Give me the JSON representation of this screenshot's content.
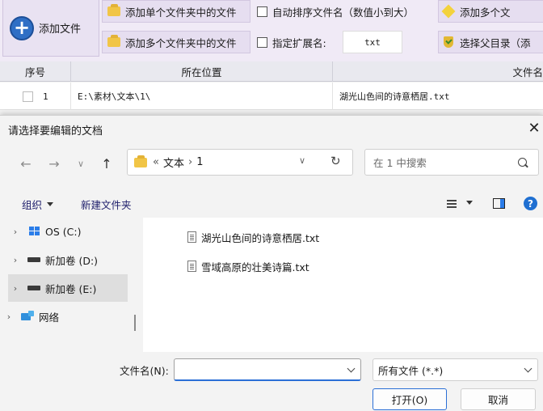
{
  "app": {
    "add_file_label": "添加文件",
    "toolbar": {
      "add_single_folder": "添加单个文件夹中的文件",
      "add_multi_folder": "添加多个文件夹中的文件",
      "auto_sort": "自动排序文件名（数值小到大）",
      "specify_ext_label": "指定扩展名:",
      "ext_value": "txt",
      "add_multi_right": "添加多个文",
      "select_parent": "选择父目录（添"
    },
    "grid": {
      "headers": [
        "序号",
        "所在位置",
        "文件名"
      ],
      "rows": [
        {
          "index": "1",
          "location": "E:\\素材\\文本\\1\\",
          "filename": "湖光山色间的诗意栖居.txt"
        }
      ]
    }
  },
  "dialog": {
    "title": "请选择要编辑的文档",
    "close_glyph": "✕",
    "address": {
      "overflow": "«",
      "crumbs": [
        "文本",
        "1"
      ]
    },
    "search_placeholder": "在 1 中搜索",
    "commands": {
      "organize": "组织",
      "new_folder": "新建文件夹"
    },
    "nav": [
      {
        "label": "OS (C:)",
        "icon": "windows-drive-icon",
        "selected": false
      },
      {
        "label": "新加卷 (D:)",
        "icon": "drive-icon",
        "selected": false
      },
      {
        "label": "新加卷 (E:)",
        "icon": "drive-icon",
        "selected": true
      },
      {
        "label": "网络",
        "icon": "network-icon",
        "selected": false
      }
    ],
    "files": [
      {
        "name": "湖光山色间的诗意栖居.txt"
      },
      {
        "name": "雪域高原的壮美诗篇.txt"
      }
    ],
    "filename_label": "文件名(N):",
    "filename_value": "",
    "filetype_value": "所有文件 (*.*)",
    "open_button": "打开(O)",
    "cancel_button": "取消"
  },
  "colors": {
    "accent": "#2b6fd6",
    "toolbar_bg": "#f0eaf6",
    "selected_nav": "#dedede"
  }
}
